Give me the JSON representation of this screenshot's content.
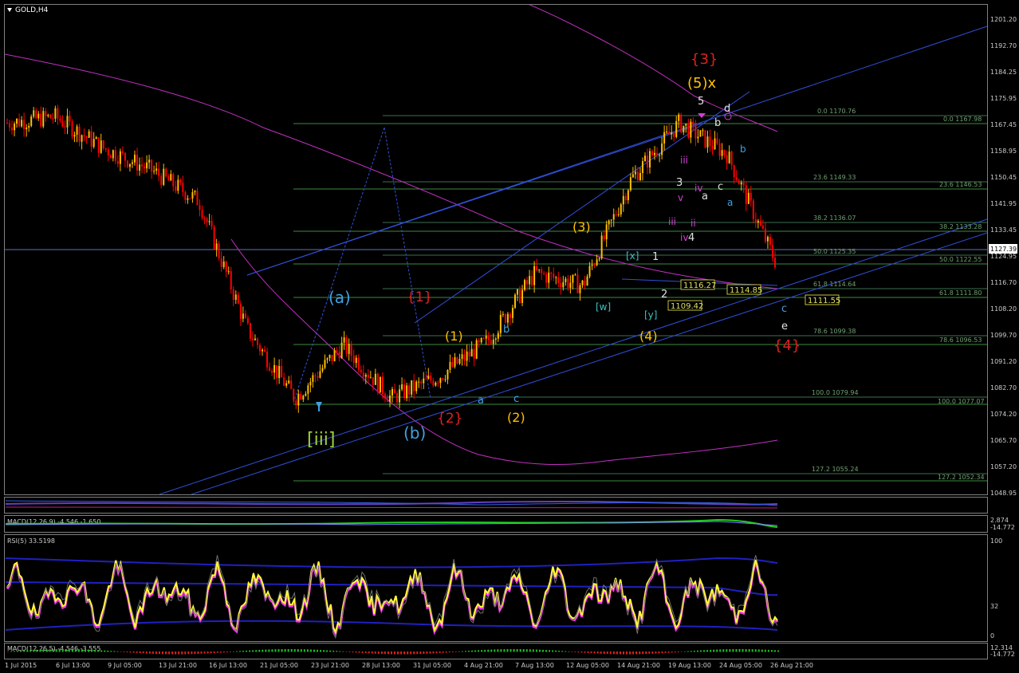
{
  "chart_title": "GOLD,H4",
  "price_axis_ticks": [
    "1201.20",
    "1192.70",
    "1184.25",
    "1175.95",
    "1167.45",
    "1158.95",
    "1150.45",
    "1141.95",
    "1133.45",
    "1124.95",
    "1116.70",
    "1108.20",
    "1099.70",
    "1091.20",
    "1082.70",
    "1074.20",
    "1065.70",
    "1057.20",
    "1048.95"
  ],
  "current_price_label": "1127.39",
  "time_axis_labels": [
    "1 Jul 2015",
    "6 Jul 13:00",
    "9 Jul 05:00",
    "13 Jul 21:00",
    "16 Jul 13:00",
    "21 Jul 05:00",
    "23 Jul 21:00",
    "28 Jul 13:00",
    "31 Jul 05:00",
    "4 Aug 21:00",
    "7 Aug 13:00",
    "12 Aug 05:00",
    "14 Aug 21:00",
    "19 Aug 13:00",
    "24 Aug 05:00",
    "26 Aug 21:00"
  ],
  "fib_levels_a": [
    "0.0  1170.76",
    "23.6  1149.33",
    "38.2  1136.07",
    "50.0  1125.35",
    "61.8  1114.64",
    "78.6  1099.38",
    "100.0  1079.94",
    "127.2  1055.24"
  ],
  "fib_levels_b": [
    "0.0  1167.98",
    "23.6  1146.53",
    "38.2  1133.28",
    "50.0  1122.55",
    "61.8  1111.80",
    "78.6  1096.53",
    "100.0  1077.07",
    "127.2  1052.34"
  ],
  "price_boxes": [
    "1116.27",
    "1109.42",
    "1114.85",
    "1111.55"
  ],
  "wave_labels": {
    "red_3": "{3}",
    "gold_5x": "(5)x",
    "five": "5",
    "d": "d",
    "b1": "b",
    "b2": "b",
    "iii": "iii",
    "three": "3",
    "a1": "a",
    "iv": "iv",
    "c1": "c",
    "vi": "v",
    "a2": "a",
    "iii2": "iii",
    "ii": "ii",
    "iv2": "iv",
    "four": "4",
    "gold_3": "(3)",
    "x": "[x]",
    "one": "1",
    "w": "[w]",
    "two": "2",
    "y": "[y]",
    "gold_4": "(4)",
    "c2": "c",
    "e": "e",
    "red_4": "{4}",
    "blue_a": "(a)",
    "red_1": "{1}",
    "gold_1": "(1)",
    "b3": "b",
    "a3": "a",
    "c3": "c",
    "red_2": "{2}",
    "gold_2": "(2)",
    "blue_b": "(b)",
    "iii_green": "[iii]"
  },
  "indicators": {
    "macd1_label": "MACD(12,26,9) -4.546 -1.650",
    "macd1_scale": [
      "2.874",
      "-14.772"
    ],
    "rsi_label": "RSI(5) 33.5198",
    "rsi_scale": [
      "100",
      "32",
      "0"
    ],
    "macd2_label": "MACD(12,26,5) -4.546 -3.555",
    "macd2_scale": [
      "12.314",
      "-14.772"
    ]
  },
  "colors": {
    "bull": "#ffc000",
    "bear": "#ff0000",
    "blue_line": "#3050d8",
    "magenta": "#c030c0",
    "fib": "#3c8c3c",
    "rsi": "#ffff30"
  },
  "chart_data": {
    "type": "candlestick",
    "symbol": "GOLD",
    "timeframe": "H4",
    "x_range": [
      "1 Jul 2015",
      "27 Aug 2015"
    ],
    "ylim": [
      1048.95,
      1201.2
    ],
    "approx_path": [
      [
        "1 Jul 2015",
        1168
      ],
      [
        "6 Jul 13:00",
        1170
      ],
      [
        "9 Jul 05:00",
        1160
      ],
      [
        "13 Jul 21:00",
        1153
      ],
      [
        "16 Jul 13:00",
        1143
      ],
      [
        "21 Jul 05:00",
        1102
      ],
      [
        "23 Jul 21:00",
        1080
      ],
      [
        "28 Jul 13:00",
        1097
      ],
      [
        "31 Jul 05:00",
        1080
      ],
      [
        "4 Aug 21:00",
        1087
      ],
      [
        "7 Aug 13:00",
        1098
      ],
      [
        "12 Aug 05:00",
        1120
      ],
      [
        "14 Aug 21:00",
        1116
      ],
      [
        "19 Aug 13:00",
        1150
      ],
      [
        "21 Aug 13:00",
        1168
      ],
      [
        "24 Aug 05:00",
        1158
      ],
      [
        "26 Aug 21:00",
        1124
      ]
    ]
  }
}
